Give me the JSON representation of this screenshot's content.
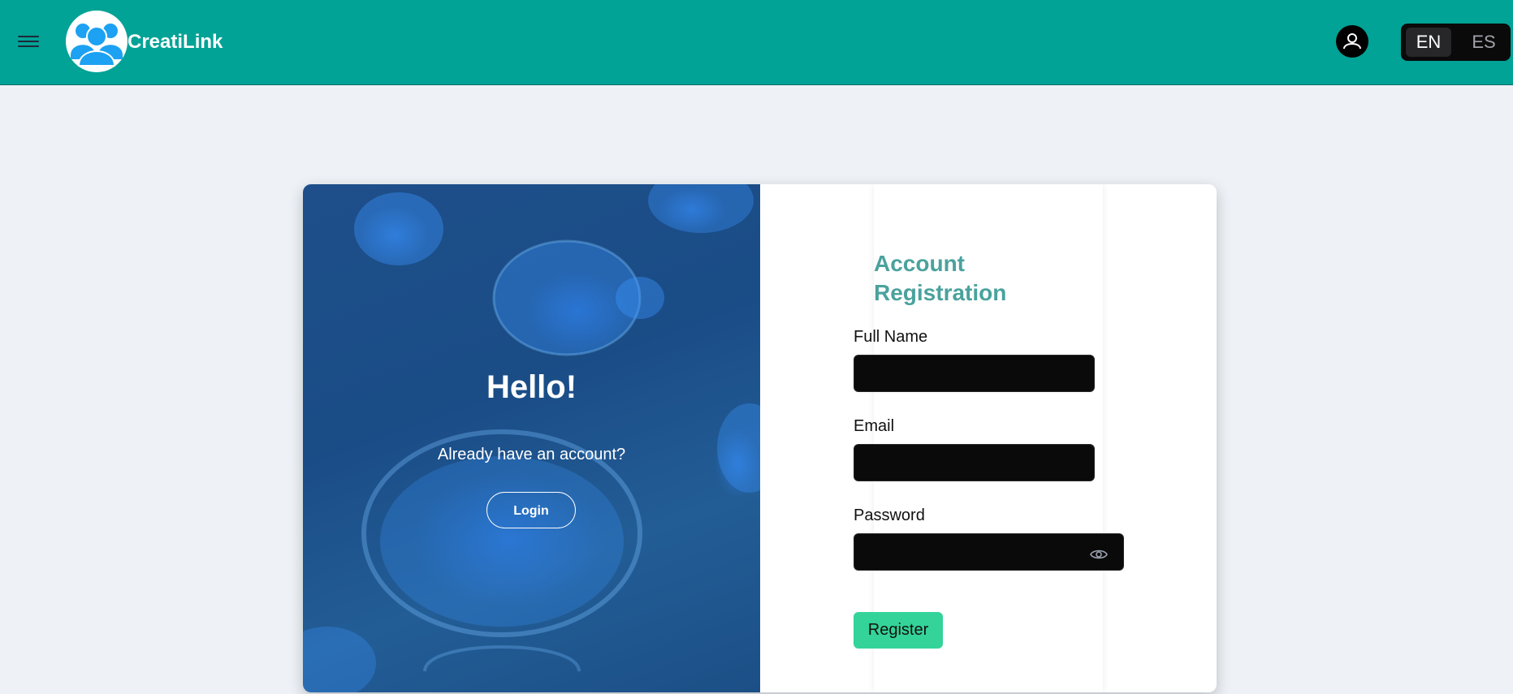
{
  "header": {
    "brand": "CreatiLink",
    "menu_icon": "hamburger-menu-icon",
    "logo_icon": "users-group-icon",
    "user_icon": "user-account-icon",
    "languages": {
      "active": "EN",
      "inactive": "ES"
    },
    "colors": {
      "bar": "#00a396",
      "logo_accent": "#1da1f2"
    }
  },
  "hero": {
    "title": "Hello!",
    "subtitle": "Already have an account?",
    "login_label": "Login"
  },
  "form": {
    "title": "Account Registration",
    "fullname_label": "Full Name",
    "fullname_value": "",
    "email_label": "Email",
    "email_value": "",
    "password_label": "Password",
    "password_value": "",
    "toggle_icon": "eye-icon",
    "register_label": "Register",
    "colors": {
      "title": "#4aa29d",
      "register": "#34d399"
    }
  }
}
